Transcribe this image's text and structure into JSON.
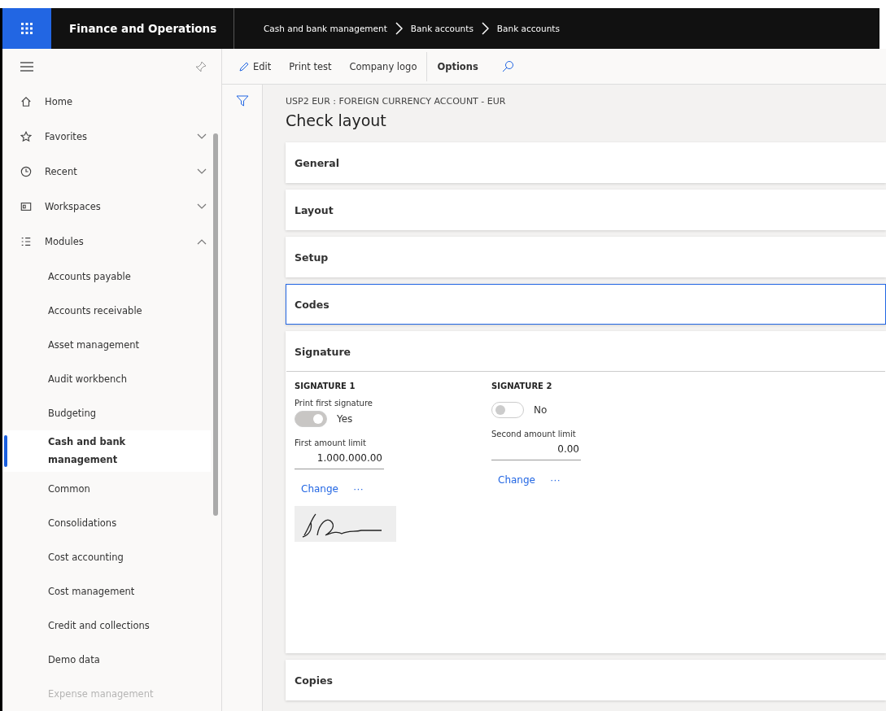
{
  "app": {
    "title": "Finance and Operations"
  },
  "breadcrumb": [
    "Cash and bank management",
    "Bank accounts",
    "Bank accounts"
  ],
  "toolbar": [
    {
      "label": "Edit",
      "kind": "edit"
    },
    {
      "label": "Print test",
      "kind": "plain"
    },
    {
      "label": "Company logo",
      "kind": "plain"
    },
    {
      "label": "Options",
      "kind": "bold"
    }
  ],
  "nav": [
    {
      "label": "Home",
      "kind": "home"
    },
    {
      "label": "Favorites",
      "kind": "star",
      "expanded": false
    },
    {
      "label": "Recent",
      "kind": "clock",
      "expanded": false
    },
    {
      "label": "Workspaces",
      "kind": "workspace",
      "expanded": false
    },
    {
      "label": "Modules",
      "kind": "modules",
      "expanded": true
    }
  ],
  "modules": [
    {
      "label": "Accounts payable",
      "selected": false
    },
    {
      "label": "Accounts receivable",
      "selected": false
    },
    {
      "label": "Asset management",
      "selected": false
    },
    {
      "label": "Audit workbench",
      "selected": false
    },
    {
      "label": "Budgeting",
      "selected": false
    },
    {
      "label": "Cash and bank management",
      "selected": true
    },
    {
      "label": "Common",
      "selected": false
    },
    {
      "label": "Consolidations",
      "selected": false
    },
    {
      "label": "Cost accounting",
      "selected": false
    },
    {
      "label": "Cost management",
      "selected": false
    },
    {
      "label": "Credit and collections",
      "selected": false
    },
    {
      "label": "Demo data",
      "selected": false
    },
    {
      "label": "Expense management",
      "selected": false
    }
  ],
  "page": {
    "subtitle": "USP2 EUR : FOREIGN CURRENCY ACCOUNT - EUR",
    "title": "Check layout"
  },
  "sections": [
    {
      "title": "General",
      "selected": false,
      "expanded": false
    },
    {
      "title": "Layout",
      "selected": false,
      "expanded": false
    },
    {
      "title": "Setup",
      "selected": false,
      "expanded": false
    },
    {
      "title": "Codes",
      "selected": true,
      "expanded": false
    },
    {
      "title": "Signature",
      "selected": false,
      "expanded": true
    },
    {
      "title": "Copies",
      "selected": false,
      "expanded": false
    }
  ],
  "signatures": [
    {
      "heading": "SIGNATURE 1",
      "toggle_label": "Print first signature",
      "on": true,
      "toggle_text": "Yes",
      "amount_label": "First amount limit",
      "amount": "1.000.000.00",
      "link": "Change",
      "more": "···",
      "has_image": true
    },
    {
      "heading": "SIGNATURE 2",
      "on": false,
      "toggle_text": "No",
      "amount_label": "Second amount limit",
      "amount": "0.00",
      "link": "Change",
      "more": "···",
      "has_image": false
    }
  ]
}
